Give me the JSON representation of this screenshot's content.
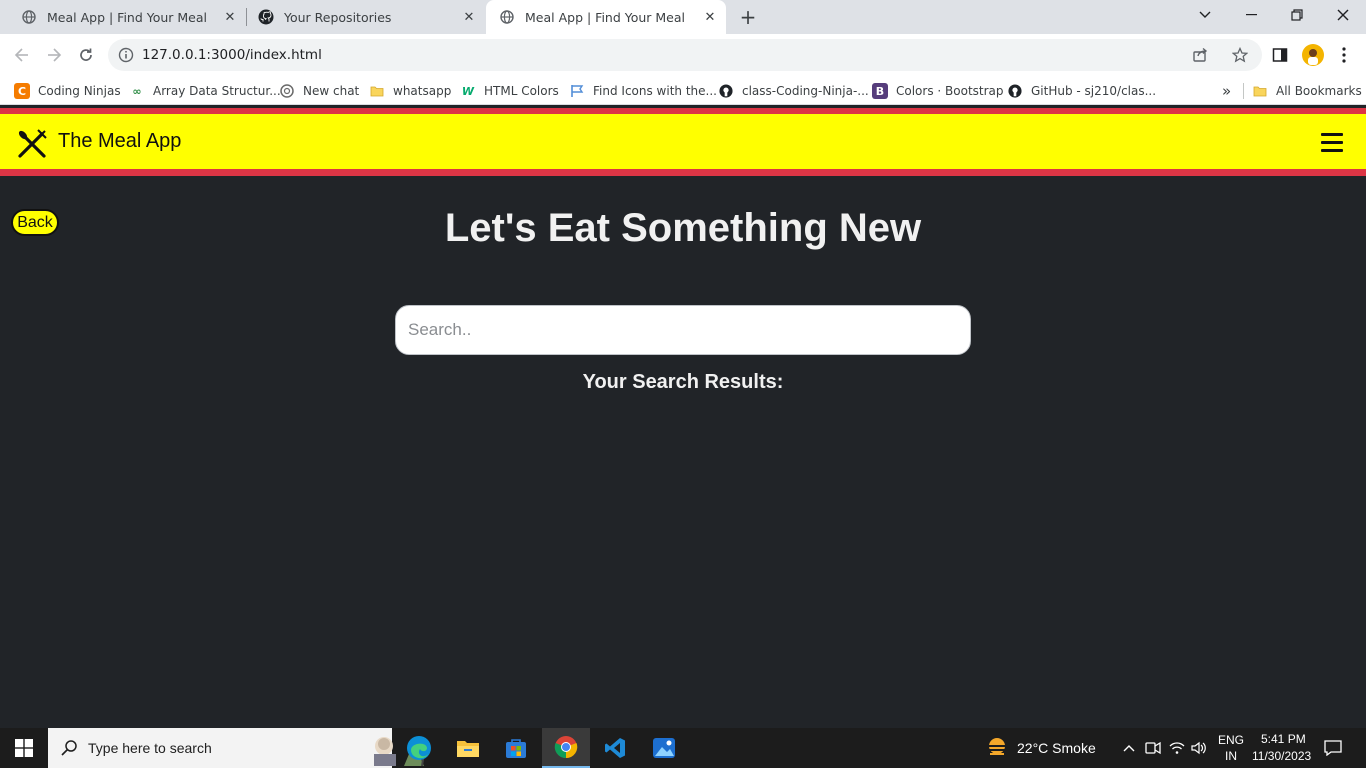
{
  "browser": {
    "tabs": [
      {
        "title": "Meal App | Find Your Meal",
        "active": false
      },
      {
        "title": "Your Repositories",
        "active": false
      },
      {
        "title": "Meal App | Find Your Meal",
        "active": true
      }
    ],
    "address": "127.0.0.1:3000/index.html",
    "bookmarks": [
      {
        "label": "Coding Ninjas",
        "icon": "coding-ninjas-icon"
      },
      {
        "label": "Array Data Structur...",
        "icon": "gfg-icon"
      },
      {
        "label": "New chat",
        "icon": "openai-icon"
      },
      {
        "label": "whatsapp",
        "icon": "folder-icon"
      },
      {
        "label": "HTML Colors",
        "icon": "w3-icon"
      },
      {
        "label": "Find Icons with the...",
        "icon": "flag-icon"
      },
      {
        "label": "class-Coding-Ninja-...",
        "icon": "github-icon"
      },
      {
        "label": "Colors · Bootstrap",
        "icon": "bootstrap-icon"
      },
      {
        "label": "GitHub - sj210/clas...",
        "icon": "github-icon"
      }
    ],
    "overflow_chevron": "»",
    "all_bookmarks": "All Bookmarks"
  },
  "app": {
    "brand": "The Meal App",
    "back_label": "Back",
    "headline": "Let's Eat Something New",
    "search_placeholder": "Search..",
    "results_title": "Your Search Results:",
    "colors": {
      "navbar": "#ffff00",
      "navbar_border": "#dc3545",
      "background": "#212428"
    }
  },
  "taskbar": {
    "search_placeholder": "Type here to search",
    "weather": "22°C  Smoke",
    "lang_top": "ENG",
    "lang_bottom": "IN",
    "time": "5:41 PM",
    "date": "11/30/2023"
  }
}
